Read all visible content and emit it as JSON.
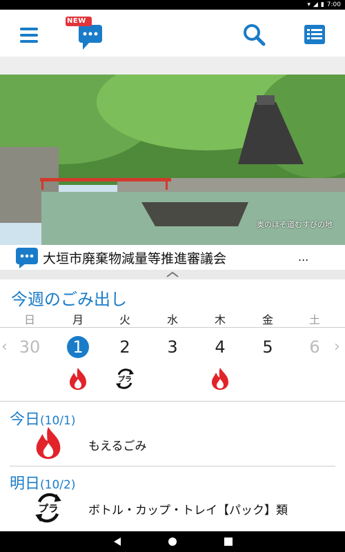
{
  "status_bar": {
    "time": "7:00"
  },
  "header": {
    "new_badge": "NEW",
    "accent": "#1a7cc8",
    "icons": [
      "menu-icon",
      "chat-icon",
      "search-icon",
      "list-icon"
    ]
  },
  "banner": {
    "caption": "奥のほそ道むすびの地"
  },
  "news": {
    "title": "大垣市廃棄物減量等推進審議会",
    "more": "..."
  },
  "week": {
    "title": "今週のごみ出し",
    "days": [
      {
        "dow": "日",
        "date": "30",
        "icon": ""
      },
      {
        "dow": "月",
        "date": "1",
        "icon": "burnable-icon"
      },
      {
        "dow": "火",
        "date": "2",
        "icon": "plastic-icon"
      },
      {
        "dow": "水",
        "date": "3",
        "icon": ""
      },
      {
        "dow": "木",
        "date": "4",
        "icon": "burnable-icon"
      },
      {
        "dow": "金",
        "date": "5",
        "icon": ""
      },
      {
        "dow": "土",
        "date": "6",
        "icon": ""
      }
    ]
  },
  "today": {
    "label": "今日",
    "date": "(10/1)",
    "item": "もえるごみ"
  },
  "tomorrow": {
    "label": "明日",
    "date": "(10/2)",
    "item": "ボトル・カップ・トレイ【パック】類"
  }
}
